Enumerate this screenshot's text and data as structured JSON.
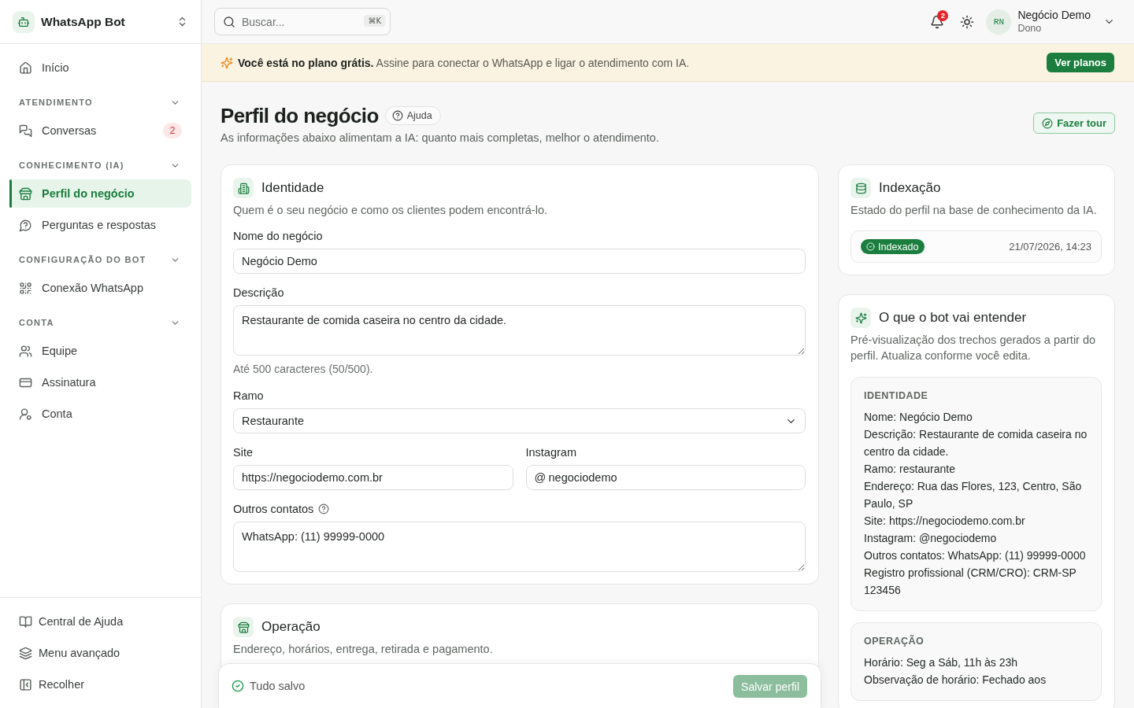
{
  "sidebar": {
    "app_name": "WhatsApp Bot",
    "top_items": [
      {
        "label": "Início",
        "selected": false
      }
    ],
    "sections": [
      {
        "title": "ATENDIMENTO",
        "expanded": true,
        "items": [
          {
            "label": "Conversas",
            "selected": false,
            "badge": "2"
          }
        ]
      },
      {
        "title": "CONHECIMENTO (IA)",
        "expanded": true,
        "items": [
          {
            "label": "Perfil do negócio",
            "selected": true
          },
          {
            "label": "Perguntas e respostas",
            "selected": false
          }
        ]
      },
      {
        "title": "CONFIGURAÇÃO DO BOT",
        "expanded": true,
        "items": [
          {
            "label": "Conexão WhatsApp",
            "selected": false
          }
        ]
      },
      {
        "title": "CONTA",
        "expanded": true,
        "items": [
          {
            "label": "Equipe",
            "selected": false
          },
          {
            "label": "Assinatura",
            "selected": false
          },
          {
            "label": "Conta",
            "selected": false
          }
        ]
      }
    ],
    "footer_items": [
      {
        "label": "Central de Ajuda"
      },
      {
        "label": "Menu avançado"
      },
      {
        "label": "Recolher"
      }
    ]
  },
  "topbar": {
    "search": {
      "placeholder": "Buscar...",
      "shortcut": "⌘K"
    },
    "notifications": {
      "count": "2"
    },
    "user": {
      "initials": "RN",
      "name": "Negócio Demo",
      "role": "Dono"
    }
  },
  "banner": {
    "text": "**Você está no plano grátis.** Assine para conectar o WhatsApp e ligar o atendimento com IA.",
    "button": "Ver planos"
  },
  "page": {
    "title": "Perfil do negócio",
    "help_button": "Ajuda",
    "subtitle": "As informações abaixo alimentam a IA: quanto mais completas, melhor o atendimento.",
    "tour_button": "Fazer tour"
  },
  "identity_card": {
    "title": "Identidade",
    "description": "Quem é o seu negócio e como os clientes podem encontrá-lo.",
    "rows": [
      [
        {
          "kind": "text",
          "label": "Nome do negócio",
          "value": "Negócio Demo",
          "help_icon": false
        }
      ],
      [
        {
          "kind": "textarea",
          "label": "Descrição",
          "value": "Restaurante de comida caseira no centro da cidade.",
          "hint": "Até 500 caracteres (50/500).",
          "help_icon": false
        }
      ],
      [
        {
          "kind": "select",
          "label": "Ramo",
          "value": "Restaurante",
          "help_icon": false
        }
      ],
      [
        {
          "kind": "text",
          "label": "Site",
          "value": "https://negociodemo.com.br",
          "help_icon": false
        },
        {
          "kind": "prefixed",
          "label": "Instagram",
          "prefix": "@",
          "value": "negociodemo",
          "help_icon": false
        }
      ],
      [
        {
          "kind": "textarea",
          "label": "Outros contatos",
          "value": "WhatsApp: (11) 99999-0000",
          "help_icon": true
        }
      ]
    ]
  },
  "operation_card": {
    "title": "Operação",
    "description": "Endereço, horários, entrega, retirada e pagamento."
  },
  "save_bar": {
    "status": "Tudo salvo",
    "saved": true,
    "button": "Salvar perfil",
    "button_disabled": true
  },
  "indexing_card": {
    "title": "Indexação",
    "description": "Estado do perfil na base de conhecimento da IA.",
    "status": "Indexado",
    "indexed": true,
    "updated_at": "21/07/2026, 14:23"
  },
  "preview_card": {
    "title": "O que o bot vai entender",
    "description": "Pré-visualização dos trechos gerados a partir do perfil. Atualiza conforme você edita.",
    "blocks": [
      {
        "heading": "IDENTIDADE",
        "lines": [
          "Nome: Negócio Demo",
          "Descrição: Restaurante de comida caseira no centro da cidade.",
          "Ramo: restaurante",
          "Endereço: Rua das Flores, 123, Centro, São Paulo, SP",
          "Site: https://negociodemo.com.br",
          "Instagram: @negociodemo",
          "Outros contatos: WhatsApp: (11) 99999-0000",
          "Registro profissional (CRM/CRO): CRM-SP 123456"
        ]
      },
      {
        "heading": "OPERAÇÃO",
        "lines": [
          "Horário: Seg a Sáb, 11h às 23h",
          "Observação de horário: Fechado aos"
        ]
      }
    ]
  }
}
